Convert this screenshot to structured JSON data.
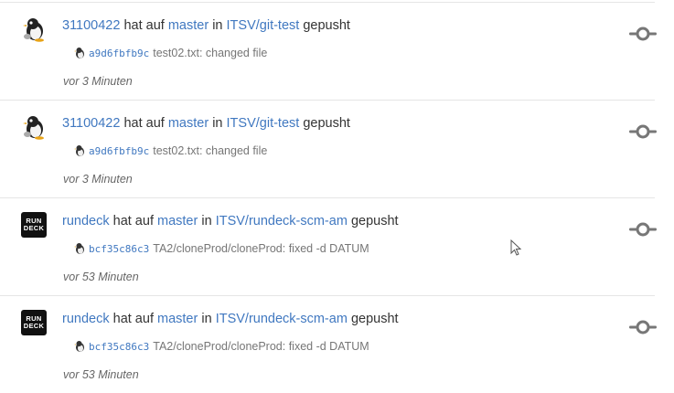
{
  "feed": {
    "items": [
      {
        "user": "31100422",
        "actor_type": "penguin",
        "text_hat_auf": "hat auf",
        "branch": "master",
        "text_in": "in",
        "repo": "ITSV/git-test",
        "text_action": "gepusht",
        "sha": "a9d6fbfb9c",
        "message": "test02.txt: changed file",
        "time": "vor 3 Minuten"
      },
      {
        "user": "31100422",
        "actor_type": "penguin",
        "text_hat_auf": "hat auf",
        "branch": "master",
        "text_in": "in",
        "repo": "ITSV/git-test",
        "text_action": "gepusht",
        "sha": "a9d6fbfb9c",
        "message": "test02.txt: changed file",
        "time": "vor 3 Minuten"
      },
      {
        "user": "rundeck",
        "actor_type": "rundeck",
        "avatar_text": [
          "RUN",
          "DECK"
        ],
        "text_hat_auf": "hat auf",
        "branch": "master",
        "text_in": "in",
        "repo": "ITSV/rundeck-scm-am",
        "text_action": "gepusht",
        "sha": "bcf35c86c3",
        "message": "TA2/cloneProd/cloneProd: fixed -d DATUM",
        "time": "vor 53 Minuten"
      },
      {
        "user": "rundeck",
        "actor_type": "rundeck",
        "avatar_text": [
          "RUN",
          "DECK"
        ],
        "text_hat_auf": "hat auf",
        "branch": "master",
        "text_in": "in",
        "repo": "ITSV/rundeck-scm-am",
        "text_action": "gepusht",
        "sha": "bcf35c86c3",
        "message": "TA2/cloneProd/cloneProd: fixed -d DATUM",
        "time": "vor 53 Minuten"
      }
    ]
  },
  "icons": {
    "avatar_penguin": "penguin-avatar-icon",
    "avatar_rundeck": "rundeck-avatar-icon",
    "commit": "git-commit-icon",
    "cursor": "mouse-cursor-icon"
  },
  "colors": {
    "link": "#4078c0",
    "text": "#333333",
    "muted": "#767676",
    "divider": "#e5e5e5",
    "commit_icon": "#777777"
  }
}
